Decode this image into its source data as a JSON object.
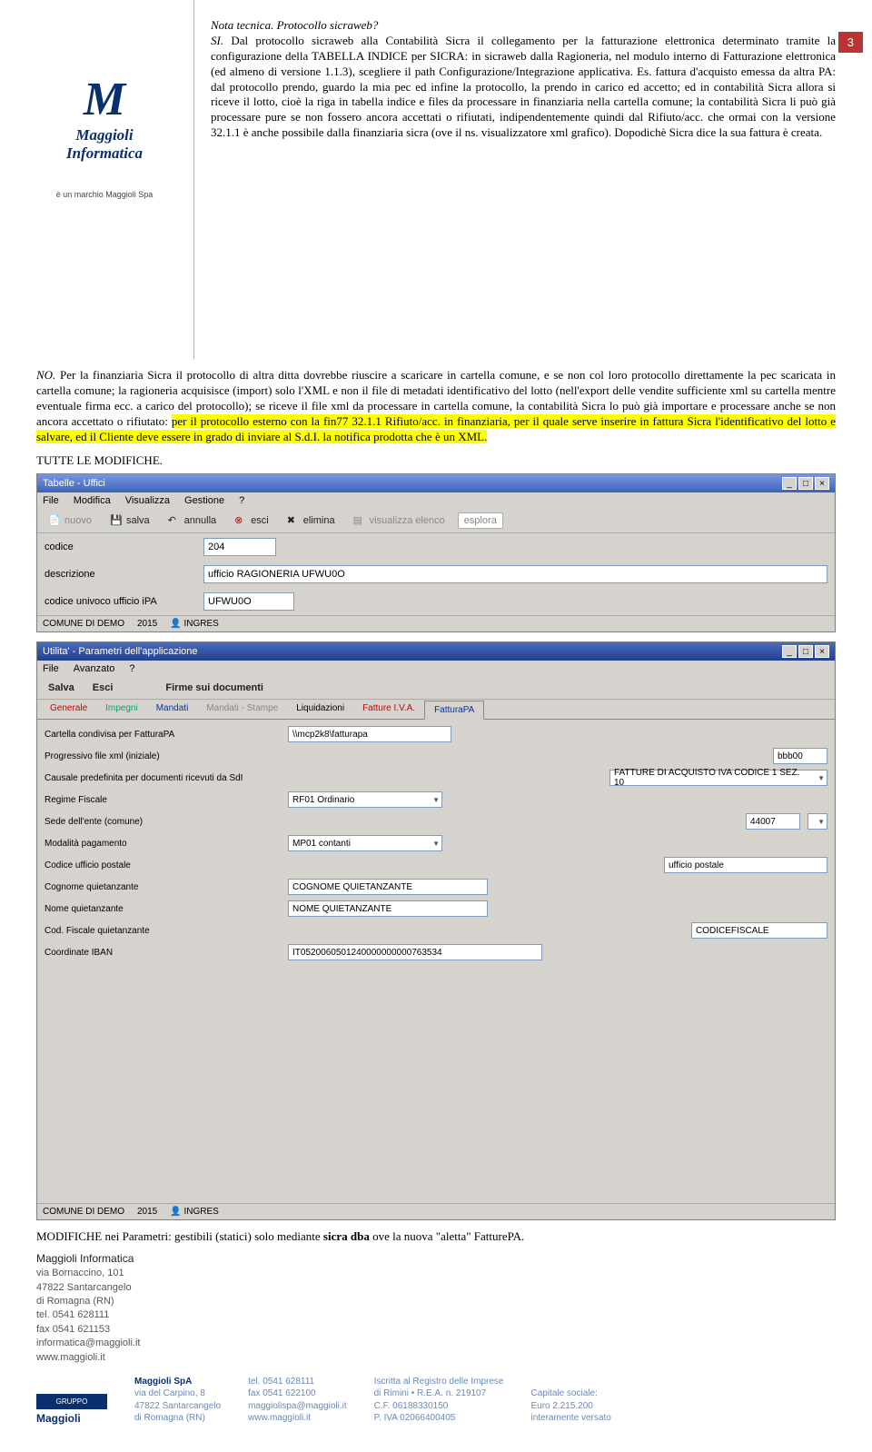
{
  "pageNumber": "3",
  "logo": {
    "brand": "Maggioli Informatica",
    "sub": "è un marchio Maggioli Spa"
  },
  "header_title": "Nota tecnica. Protocollo sicraweb?",
  "para1_si": "SI.",
  "para1": " Dal protocollo sicraweb alla Contabilità Sicra il collegamento per la fatturazione elettronica determinato tramite la configurazione della TABELLA INDICE per SICRA: in sicraweb dalla Ragioneria, nel modulo interno di Fatturazione elettronica (ed almeno di versione 1.1.3), scegliere il path Configurazione/Integrazione applicativa. Es. fattura d'acquisto emessa da altra PA: dal protocollo prendo, guardo la mia pec ed infine la protocollo, la prendo in carico ed accetto; ed in contabilità Sicra allora si riceve il lotto, cioè la riga in tabella indice e files da processare in finanziaria nella cartella comune; la contabilità Sicra li può già processare pure se non fossero ancora accettati o rifiutati, indipendentemente quindi dal Rifiuto/acc. che ormai con la versione 32.1.1 è anche possibile dalla finanziaria sicra (ove il ns. visualizzatore xml grafico). Dopodichè Sicra dice la sua fattura è creata.",
  "para2_no": "NO.",
  "para2a": " Per la finanziaria Sicra  il protocollo di altra ditta dovrebbe riuscire a scaricare in cartella comune, e se non col loro protocollo direttamente la pec scaricata in cartella comune; la ragioneria acquisisce (import) solo l'XML e non il file di metadati identificativo del lotto (nell'export delle vendite sufficiente xml su cartella mentre eventuale firma ecc. a carico del protocollo); se riceve il file xml da processare in cartella comune, la contabilità Sicra lo può già importare e processare anche se non  ancora accettato o rifiutato: ",
  "para2_hl": "per il protocollo esterno con la fin77 32.1.1 Rifiuto/acc. in finanziaria, per il quale serve inserire in fattura Sicra l'identificativo del lotto e salvare, ed il Cliente deve essere in grado di inviare al S.d.I. la notifica prodotta che è un XML.",
  "subhead1": "TUTTE LE MODIFICHE.",
  "win1": {
    "title": "Tabelle - Uffici",
    "menu": [
      "File",
      "Modifica",
      "Visualizza",
      "Gestione",
      "?"
    ],
    "toolbar": {
      "nuovo": "nuovo",
      "salva": "salva",
      "annulla": "annulla",
      "esci": "esci",
      "elimina": "elimina",
      "visualizza": "visualizza elenco",
      "esplora": "esplora"
    },
    "fields": {
      "codice_label": "codice",
      "codice": "204",
      "descrizione_label": "descrizione",
      "descrizione": "ufficio RAGIONERIA UFWU0O",
      "ipa_label": "codice univoco ufficio iPA",
      "ipa": "UFWU0O"
    },
    "status": {
      "ente": "COMUNE DI DEMO",
      "anno": "2015",
      "user": "INGRES"
    }
  },
  "win2": {
    "title": "Utilita' - Parametri dell'applicazione",
    "menu": [
      "File",
      "Avanzato",
      "?"
    ],
    "toolbar": {
      "salva": "Salva",
      "esci": "Esci",
      "firme": "Firme sui documenti"
    },
    "tabs": [
      "Generale",
      "Impegni",
      "Mandati",
      "Mandati - Stampe",
      "Liquidazioni",
      "Fatture I.V.A.",
      "FatturaPA"
    ],
    "rows": {
      "r1l": "Cartella condivisa per FatturaPA",
      "r1v": "\\\\mcp2k8\\fatturapa",
      "r2l": "Progressivo file xml (iniziale)",
      "r2v": "bbb00",
      "r3l": "Causale predefinita per documenti ricevuti da SdI",
      "r3v": "FATTURE DI ACQUISTO IVA CODICE 1 SEZ. 10",
      "r4l": "Regime Fiscale",
      "r4v": "RF01 Ordinario",
      "r5l": "Sede dell'ente (comune)",
      "r5v": "44007",
      "r6l": "Modalità pagamento",
      "r6v": "MP01 contanti",
      "r7l": "Codice ufficio postale",
      "r7v": "ufficio postale",
      "r8l": "Cognome quietanzante",
      "r8v": "COGNOME QUIETANZANTE",
      "r9l": "Nome quietanzante",
      "r9v": "NOME QUIETANZANTE",
      "r10l": "Cod. Fiscale quietanzante",
      "r10v": "CODICEFISCALE",
      "r11l": "Coordinate IBAN",
      "r11v": "IT0520060501240000000000763534"
    },
    "status": {
      "ente": "COMUNE DI DEMO",
      "anno": "2015",
      "user": "INGRES"
    }
  },
  "notes2a": "MODIFICHE nei Parametri: gestibili (statici) solo mediante ",
  "notes2b": "sicra dba",
  "notes2c": " ove la nuova \"aletta\" FatturePA.",
  "footer_addr": {
    "title": "Maggioli Informatica",
    "l1": "via Bornaccino, 101",
    "l2": "47822 Santarcangelo",
    "l3": "di Romagna (RN)",
    "l4": "tel. 0541 628111",
    "l5": "fax 0541 621153",
    "l6": "informatica@maggioli.it",
    "l7": "www.maggioli.it"
  },
  "footer_cols": {
    "gruppo": "GRUPPO",
    "brand": "Maggioli",
    "c1": {
      "l1": "Maggioli SpA",
      "l2": "via del Carpino, 8",
      "l3": "47822 Santarcangelo",
      "l4": "di Romagna (RN)"
    },
    "c2": {
      "l1": "tel. 0541 628111",
      "l2": "fax 0541 622100",
      "l3": "maggiolispa@maggioli.it",
      "l4": "www.maggioli.it"
    },
    "c3": {
      "l1": "Iscritta al Registro delle Imprese",
      "l2": "di Rimini • R.E.A. n. 219107",
      "l3": "C.F. 06188330150",
      "l4": "P. IVA 02066400405"
    },
    "c4": {
      "l1": "Capitale sociale:",
      "l2": "Euro 2.215.200",
      "l3": "interamente versato"
    }
  }
}
